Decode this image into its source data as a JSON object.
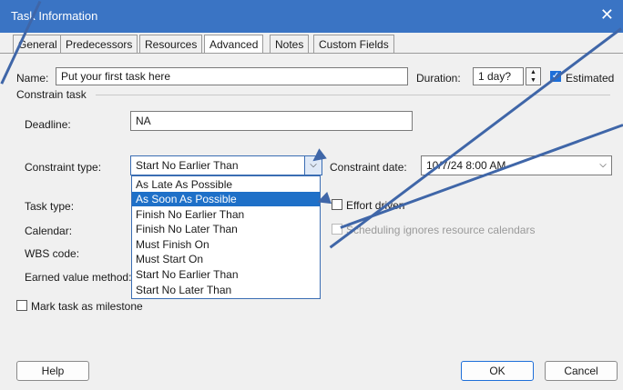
{
  "window": {
    "title": "Task Information",
    "close": "✕"
  },
  "tabs": [
    "General",
    "Predecessors",
    "Resources",
    "Advanced",
    "Notes",
    "Custom Fields"
  ],
  "active_tab": "Advanced",
  "name": {
    "label": "Name:",
    "value": "Put your first task here"
  },
  "duration": {
    "label": "Duration:",
    "value": "1 day?",
    "spin_up": "▲",
    "spin_down": "▼"
  },
  "estimated": {
    "label": "Estimated",
    "checked": true
  },
  "section": "Constrain task",
  "deadline": {
    "label": "Deadline:",
    "value": "NA"
  },
  "constraint_type": {
    "label": "Constraint type:",
    "value": "Start No Earlier Than"
  },
  "constraint_date": {
    "label": "Constraint date:",
    "value": "10/7/24 8:00 AM"
  },
  "dropdown_options": [
    "As Late As Possible",
    "As Soon As Possible",
    "Finish No Earlier Than",
    "Finish No Later Than",
    "Must Finish On",
    "Must Start On",
    "Start No Earlier Than",
    "Start No Later Than"
  ],
  "dropdown_selected": "As Soon As Possible",
  "task_type": {
    "label": "Task type:"
  },
  "effort_driven": {
    "label": "Effort driven",
    "checked": false
  },
  "calendar": {
    "label": "Calendar:"
  },
  "scheduling_ignores": {
    "label": "Scheduling ignores resource calendars",
    "checked": false,
    "disabled": true
  },
  "wbs_code": {
    "label": "WBS code:"
  },
  "earned_value": {
    "label": "Earned value method:"
  },
  "milestone": {
    "label": "Mark task as milestone",
    "checked": false
  },
  "buttons": {
    "help": "Help",
    "ok": "OK",
    "cancel": "Cancel"
  },
  "chevron": "⌵",
  "check": "✓"
}
